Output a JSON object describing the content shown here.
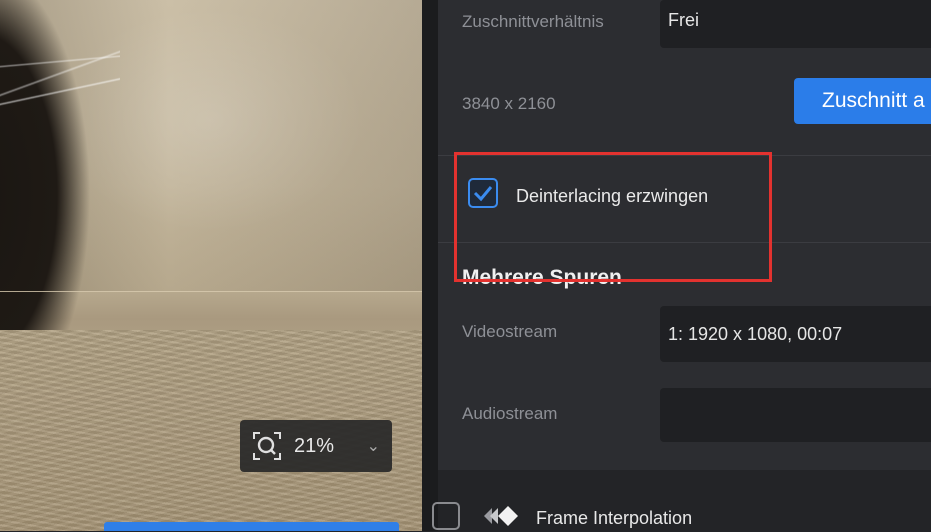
{
  "preview": {
    "zoom_value": "21%"
  },
  "panel": {
    "aspect_label": "Zuschnittverhältnis",
    "aspect_value": "Frei",
    "resolution": "3840 x 2160",
    "crop_button": "Zuschnitt a",
    "deinterlace_label": "Deinterlacing erzwingen",
    "deinterlace_checked": true,
    "multi_track_title": "Mehrere Spuren",
    "videostream_label": "Videostream",
    "videostream_value": "1: 1920 x 1080,  00:07",
    "audiostream_label": "Audiostream",
    "audiostream_value": ""
  },
  "footer": {
    "frame_interpolation_label": "Frame Interpolation",
    "frame_interpolation_checked": false
  },
  "colors": {
    "accent": "#2b7de9",
    "highlight": "#e3322f",
    "panel_bg": "#2c2d31"
  }
}
